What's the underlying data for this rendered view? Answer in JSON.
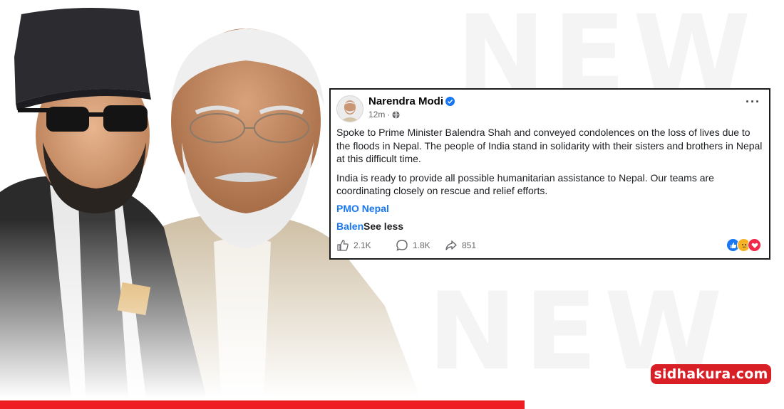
{
  "post": {
    "author": "Narendra Modi",
    "time": "12m",
    "paragraphs": [
      "Spoke to Prime Minister Balendra Shah and conveyed condolences on the loss of lives due to the floods in Nepal. The people of India stand in solidarity with their sisters and brothers in Nepal at this difficult time.",
      "India is ready to provide all possible humanitarian assistance to Nepal. Our teams are coordinating closely on rescue and relief efforts."
    ],
    "mentions": [
      "PMO Nepal",
      "Balen"
    ],
    "see_less": "See less",
    "stats": {
      "likes": "2.1K",
      "comments": "1.8K",
      "shares": "851"
    },
    "more_icon": "more-options-icon"
  },
  "site": {
    "badge": "sidhakura.com"
  },
  "colors": {
    "accent": "#1877f2",
    "badge": "#d91f26",
    "bar": "#ee1d23"
  }
}
